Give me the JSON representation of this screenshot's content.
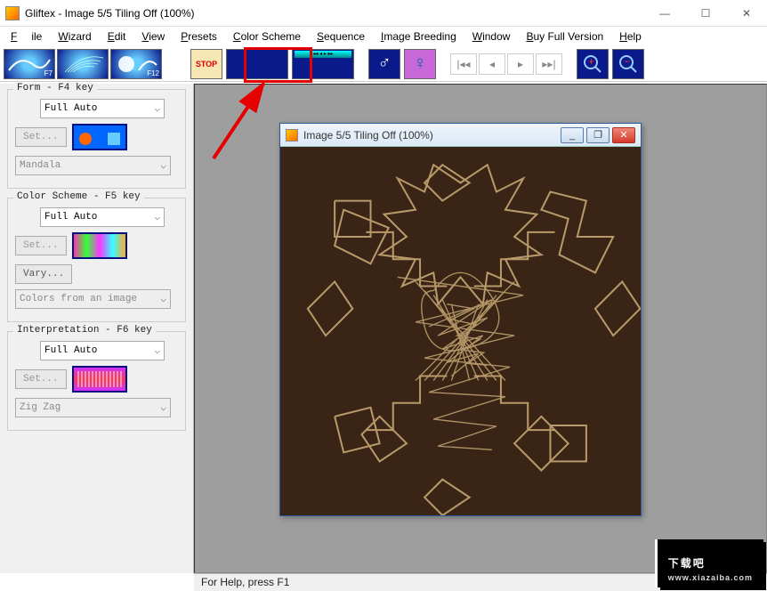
{
  "window": {
    "title": "Gliftex -  Image 5/5 Tiling Off (100%)",
    "min": "—",
    "max": "☐",
    "close": "✕"
  },
  "menu": {
    "file": "File",
    "wizard": "Wizard",
    "edit": "Edit",
    "view": "View",
    "presets": "Presets",
    "color_scheme": "Color Scheme",
    "sequence": "Sequence",
    "image_breeding": "Image Breeding",
    "window": "Window",
    "buy_full": "Buy Full Version",
    "help": "Help"
  },
  "toolbar": {
    "f7": "F7",
    "f12": "F12",
    "stop": "STOP",
    "nav_first": "|◂◂",
    "nav_prev": "◂",
    "nav_next": "▸",
    "nav_last": "▸▸|",
    "male": "♂",
    "female": "♀",
    "zoom_in": "+",
    "zoom_out": "−"
  },
  "sidebar": {
    "form": {
      "title": "Form - F4 key",
      "mode": "Full Auto",
      "set": "Set...",
      "preset": "Mandala"
    },
    "color": {
      "title": "Color Scheme - F5 key",
      "mode": "Full Auto",
      "set": "Set...",
      "vary": "Vary...",
      "preset": "Colors from an image"
    },
    "interp": {
      "title": "Interpretation - F6 key",
      "mode": "Full Auto",
      "set": "Set...",
      "preset": "Zig Zag"
    }
  },
  "inner_window": {
    "title": "Image 5/5 Tiling Off (100%)",
    "min": "_",
    "max": "❐",
    "close": "✕"
  },
  "status": {
    "help": "For Help, press F1"
  },
  "watermark": {
    "text": "下载吧",
    "url": "www.xiazaiba.com"
  }
}
